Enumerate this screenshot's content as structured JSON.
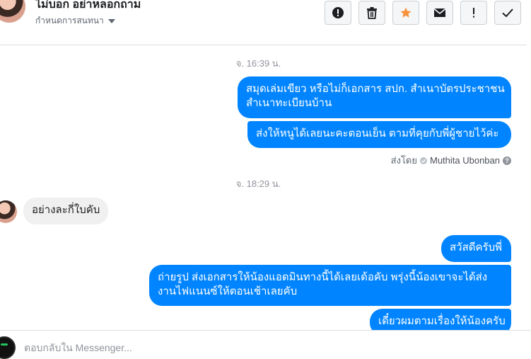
{
  "header": {
    "name": "ไม่บอก อย่าหลอกถาม",
    "subtitle": "กำหนดการสนทนา",
    "toolbar": [
      {
        "name": "report-button",
        "icon": "exclamation-circle-icon"
      },
      {
        "name": "delete-button",
        "icon": "trash-icon"
      },
      {
        "name": "star-button",
        "icon": "star-icon"
      },
      {
        "name": "mark-unread-button",
        "icon": "envelope-icon"
      },
      {
        "name": "spam-button",
        "icon": "exclamation-icon"
      },
      {
        "name": "done-button",
        "icon": "check-icon"
      }
    ],
    "star_color": "#f7923b"
  },
  "thread": {
    "timestamp_1": "จ. 16:39 น.",
    "msg_1_line_1": "สมุดเล่มเขียว หรือไม่ก็เอกสาร สปก. สำเนาบัตรประชาชน",
    "msg_1_line_2": "สำเนาทะเบียนบ้าน",
    "msg_2": "ส่งให้หนูได้เลยนะคะตอนเย็น ตามที่คุยกับพี่ผู้ชายไว้ค่ะ",
    "sent_by_label": "ส่งโดย",
    "sent_by_name": "Muthita Ubonban",
    "timestamp_2": "จ. 18:29 น.",
    "msg_3": "อย่างละกี่ใบคับ",
    "msg_4": "สวัสดีครับพี่",
    "msg_5_line_1": "ถ่ายรูป ส่งเอกสารให้น้องแอดมินทางนี้ได้เลยเด้อคับ พรุ่งนี้น้องเขาจะได้ส่ง",
    "msg_5_line_2": "งานไฟแนนซ์ให้ตอนเช้าเลยคับ",
    "msg_6_partial": "เดี๋ยวผมตามเรื่องให้น้องครับ"
  },
  "composer": {
    "placeholder": "ตอบกลับใน Messenger..."
  },
  "colors": {
    "outgoing_bubble": "#0084ff",
    "incoming_bubble": "#f1f0f0"
  }
}
